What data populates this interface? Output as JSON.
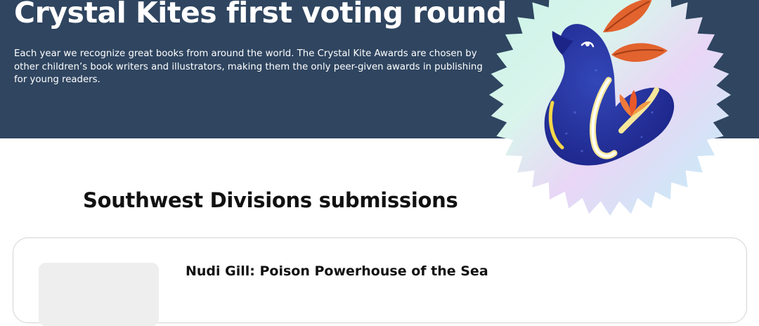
{
  "hero": {
    "title": "Crystal Kites first voting round",
    "description": "Each year we recognize great books from around the world. The Crystal Kite Awards are chosen by other children’s book writers and illustrators, making them the only peer-given awards in publishing for young readers.",
    "background_color": "#2f4560",
    "badge_icon": "crystal-kite-seal-bird-icon"
  },
  "section": {
    "title": "Southwest Divisions submissions"
  },
  "submissions": [
    {
      "title": "Nudi Gill: Poison Powerhouse of the Sea"
    }
  ]
}
